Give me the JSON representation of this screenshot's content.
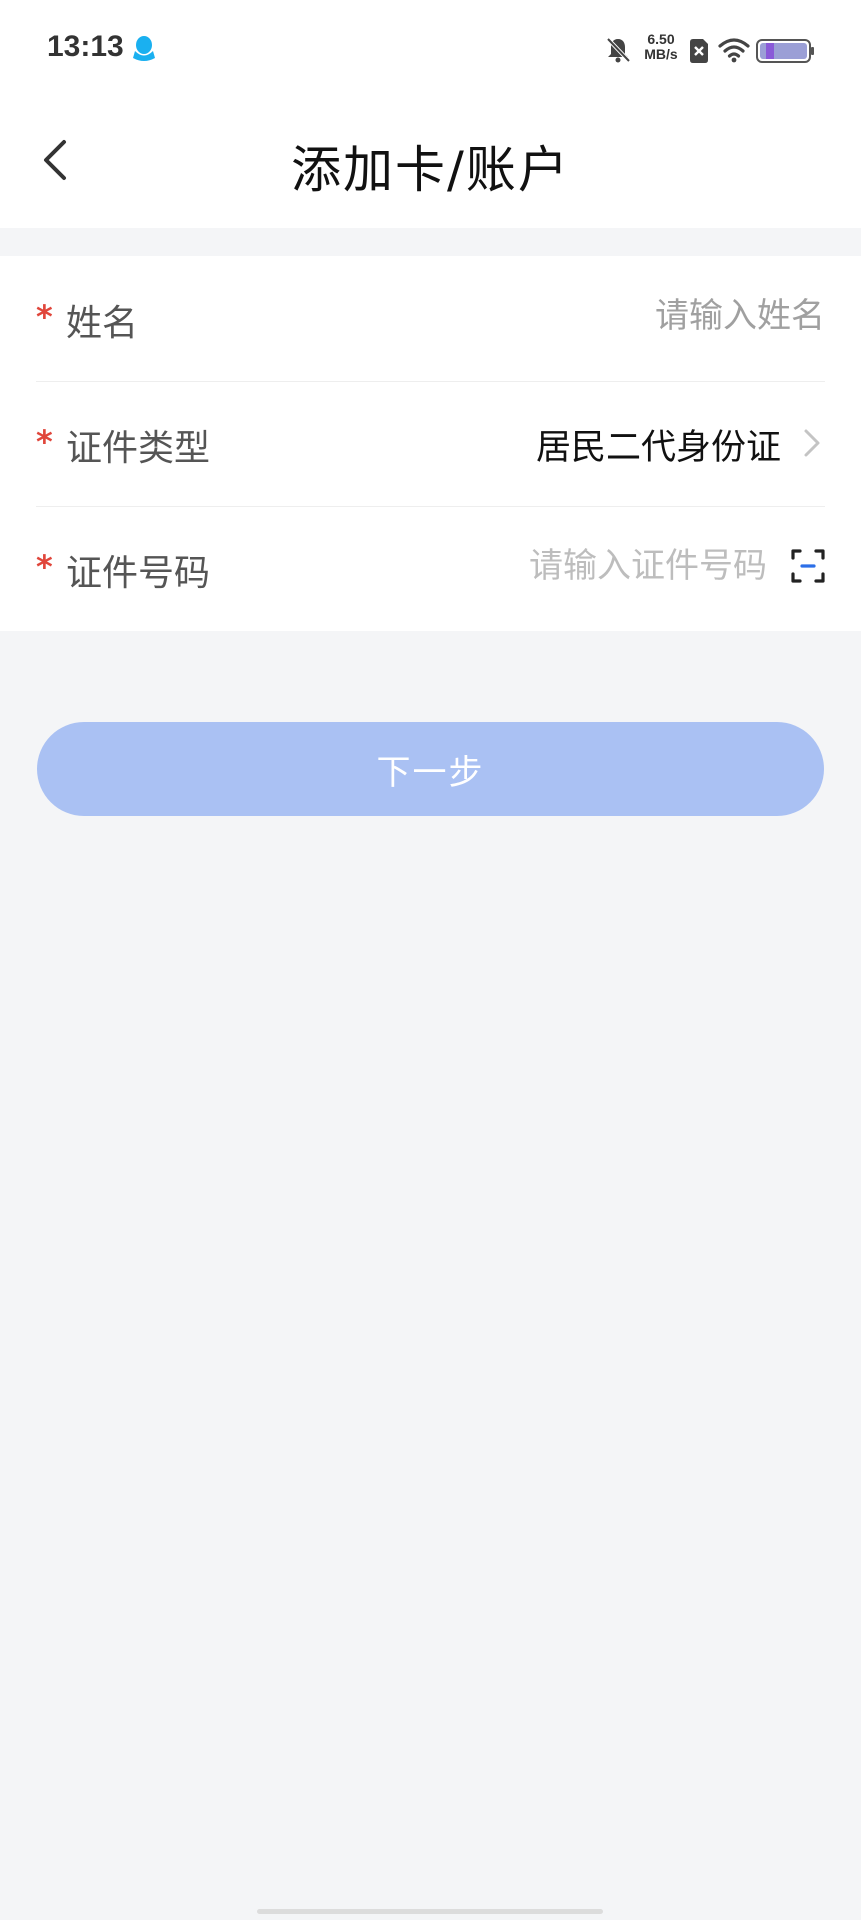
{
  "status_bar": {
    "time": "13:13",
    "net_speed_value": "6.50",
    "net_speed_unit": "MB/s",
    "icons": [
      "qq-icon",
      "bell-muted-icon",
      "sim-off-icon",
      "wifi-icon",
      "battery-icon"
    ]
  },
  "header": {
    "title": "添加卡/账户",
    "back_icon": "chevron-left-icon"
  },
  "form": {
    "required_mark": "*",
    "name": {
      "label": "姓名",
      "placeholder": "请输入姓名",
      "value": ""
    },
    "id_type": {
      "label": "证件类型",
      "value": "居民二代身份证",
      "icon": "chevron-right-icon"
    },
    "id_number": {
      "label": "证件号码",
      "placeholder": "请输入证件号码",
      "value": "",
      "icon": "scan-icon"
    }
  },
  "next_button": {
    "label": "下一步",
    "color": "#aac1f3"
  },
  "colors": {
    "required": "#e0463b",
    "background": "#f4f5f7"
  }
}
